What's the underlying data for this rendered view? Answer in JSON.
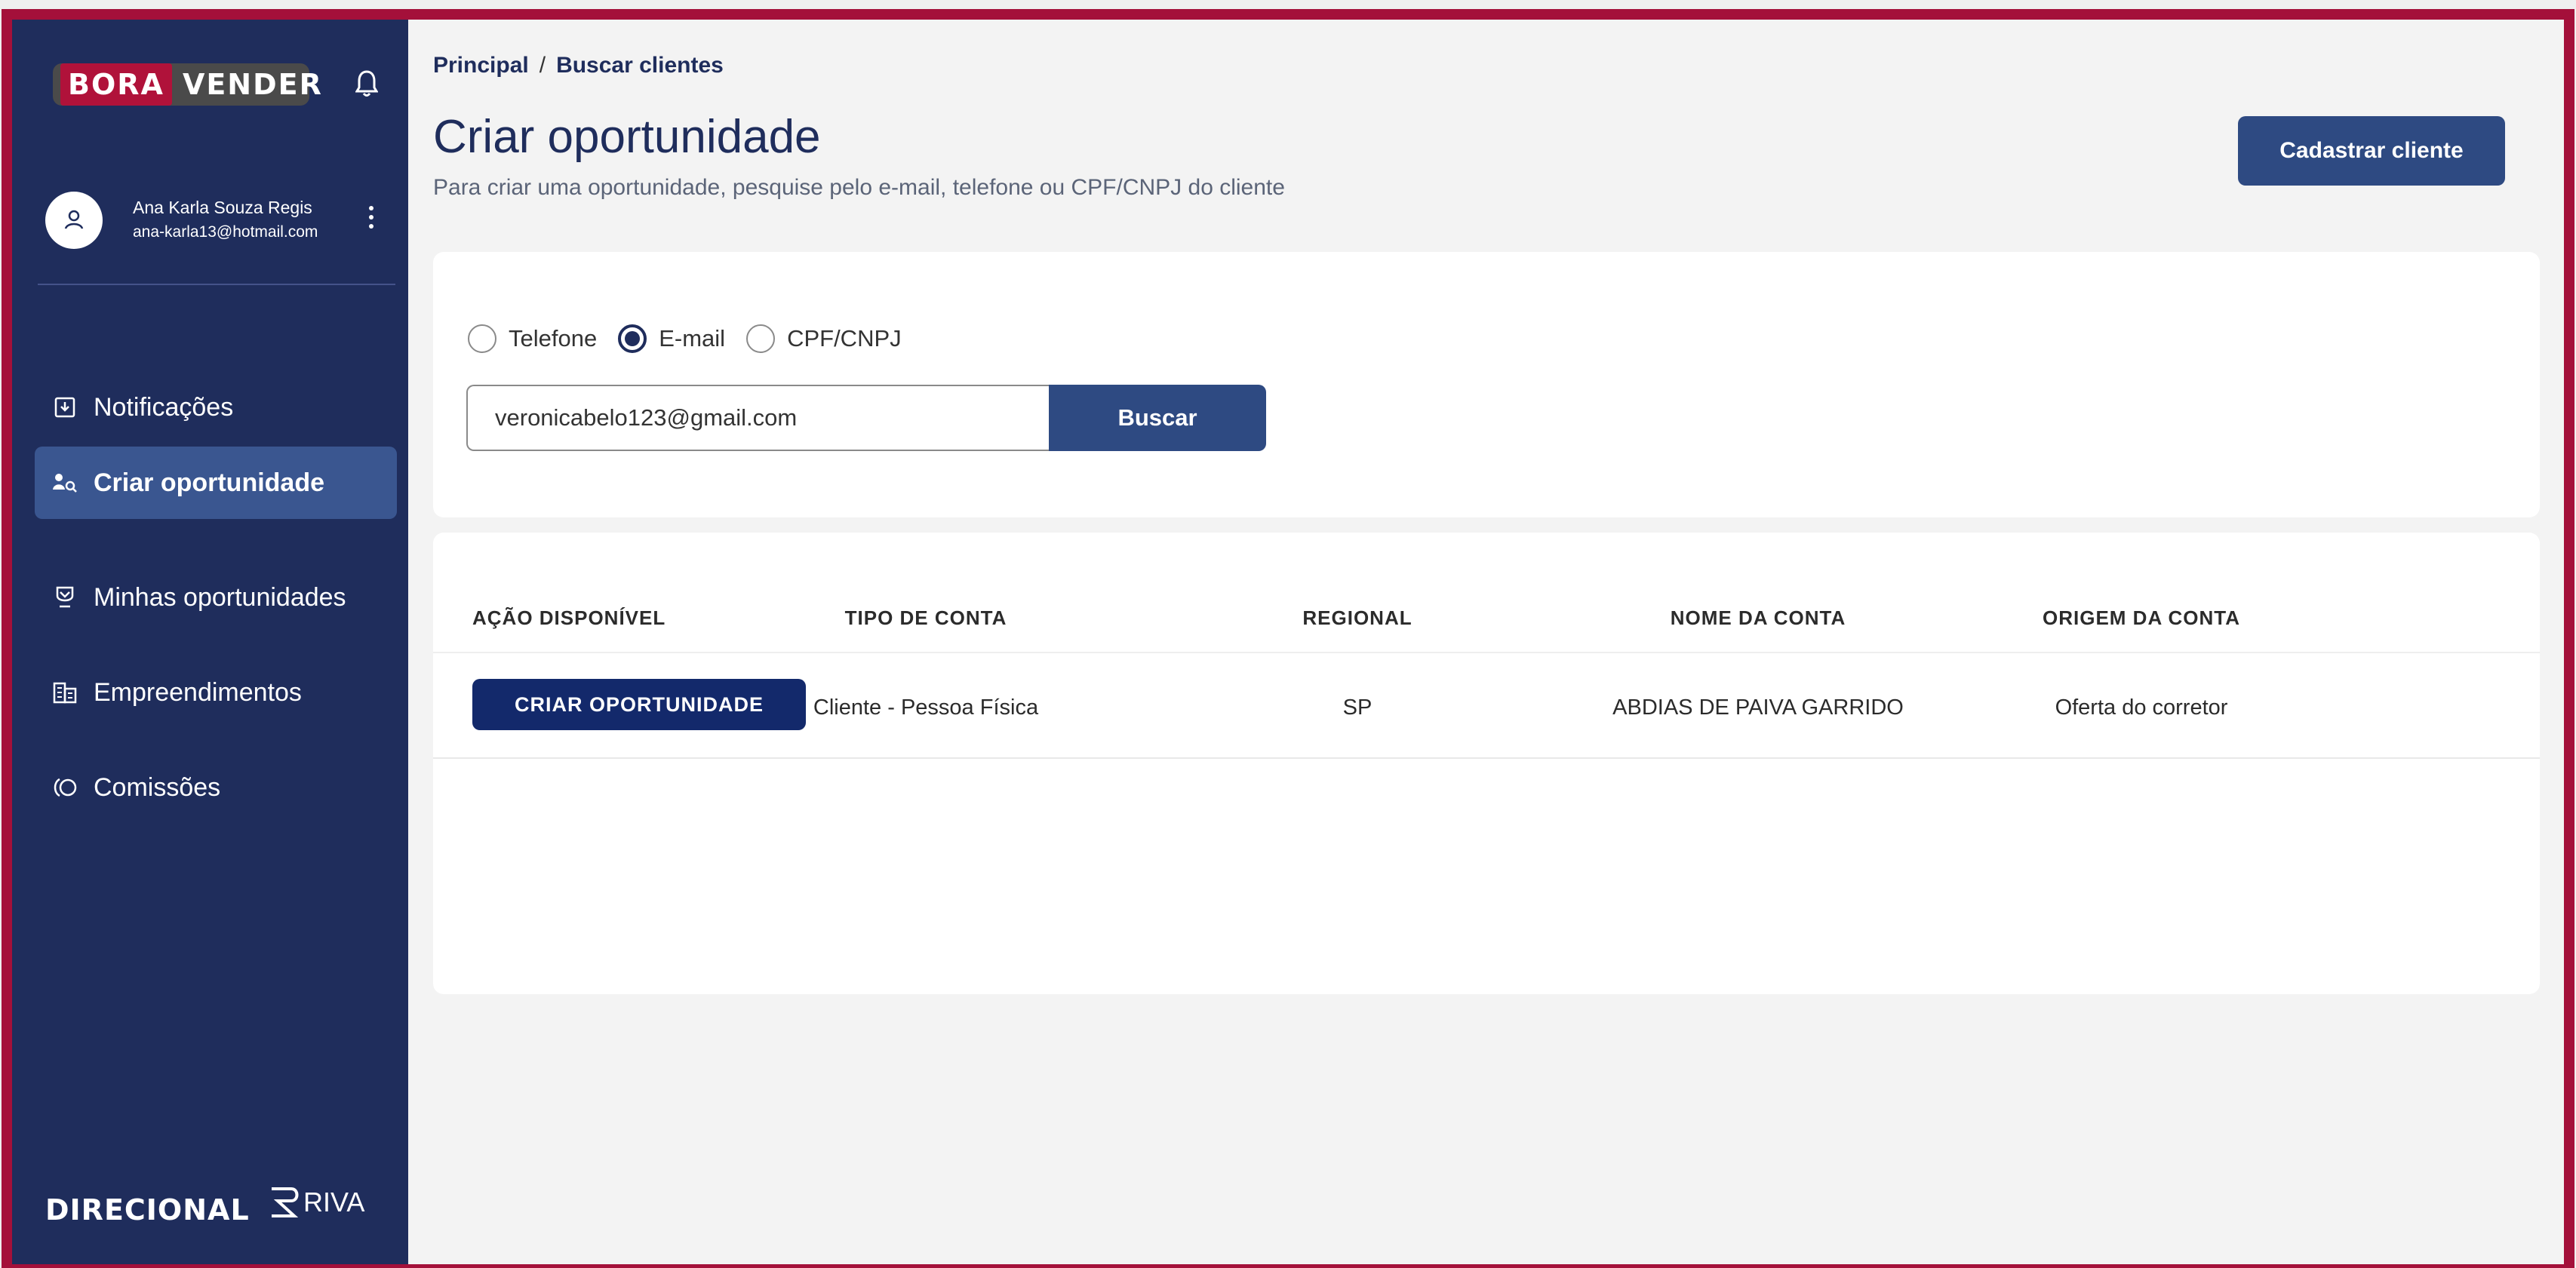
{
  "brand": {
    "logo_part1": "BORA",
    "logo_part2": "VENDER",
    "footer_left": "DIRECIONAL",
    "footer_right": "RIVA"
  },
  "user": {
    "name": "Ana Karla Souza Regis",
    "email": "ana-karla13@hotmail.com"
  },
  "sidebar": {
    "items": [
      {
        "label": "Notificações",
        "icon": "inbox-icon",
        "active": false
      },
      {
        "label": "Criar oportunidade",
        "icon": "user-search-icon",
        "active": true
      },
      {
        "label": "Minhas oportunidades",
        "icon": "award-icon",
        "active": false
      },
      {
        "label": "Empreendimentos",
        "icon": "building-icon",
        "active": false
      },
      {
        "label": "Comissões",
        "icon": "commission-icon",
        "active": false
      }
    ]
  },
  "breadcrumb": {
    "root": "Principal",
    "separator": "/",
    "current": "Buscar clientes"
  },
  "page": {
    "title": "Criar oportunidade",
    "subtitle": "Para criar uma oportunidade, pesquise pelo e-mail, telefone ou CPF/CNPJ do cliente",
    "register_button": "Cadastrar cliente"
  },
  "search": {
    "options": [
      "Telefone",
      "E-mail",
      "CPF/CNPJ"
    ],
    "selected": "E-mail",
    "value": "veronicabelo123@gmail.com",
    "button": "Buscar"
  },
  "table": {
    "headers": [
      "AÇÃO DISPONÍVEL",
      "TIPO DE CONTA",
      "REGIONAL",
      "NOME DA CONTA",
      "ORIGEM DA CONTA"
    ],
    "rows": [
      {
        "action": "CRIAR OPORTUNIDADE",
        "tipo": "Cliente - Pessoa Física",
        "regional": "SP",
        "nome": "ABDIAS DE PAIVA GARRIDO",
        "origem": "Oferta do corretor"
      }
    ]
  },
  "colors": {
    "sidebar": "#1f2d5c",
    "sidebar_active": "#3a5690",
    "primary_button": "#2e4a82",
    "action_button": "#13296b",
    "frame_border": "#a4103a"
  }
}
